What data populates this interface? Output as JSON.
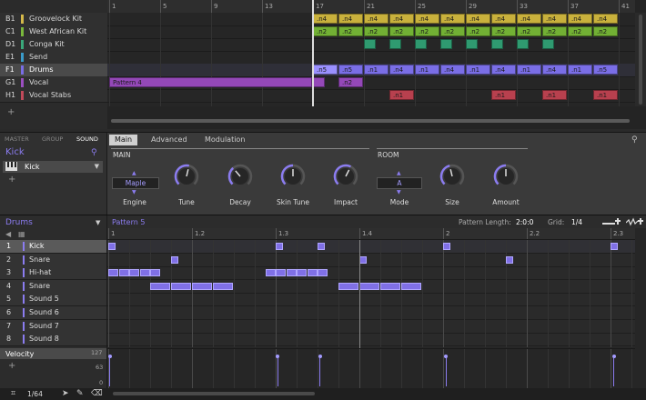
{
  "arranger": {
    "bars": [
      "1",
      "5",
      "9",
      "13",
      "17",
      "21",
      "25",
      "29",
      "33",
      "37",
      "41"
    ],
    "groups": [
      {
        "id": "B1",
        "name": "Groovelock Kit",
        "color": "#d4b84a"
      },
      {
        "id": "C1",
        "name": "West African Kit",
        "color": "#7ab83c"
      },
      {
        "id": "D1",
        "name": "Conga Kit",
        "color": "#3aa87a"
      },
      {
        "id": "E1",
        "name": "Send",
        "color": "#3a9ac8"
      },
      {
        "id": "F1",
        "name": "Drums",
        "color": "#7a6ee6"
      },
      {
        "id": "G1",
        "name": "Vocal",
        "color": "#9b4fc0"
      },
      {
        "id": "H1",
        "name": "Vocal Stabs",
        "color": "#c04a5a"
      }
    ],
    "add_label": "+",
    "clips": [
      {
        "lane": 0,
        "start": 17,
        "len": 2,
        "label": ".n4",
        "color": "#c9b13c"
      },
      {
        "lane": 0,
        "start": 19,
        "len": 2,
        "label": ".n4",
        "color": "#c9b13c"
      },
      {
        "lane": 0,
        "start": 21,
        "len": 2,
        "label": ".n4",
        "color": "#c9b13c"
      },
      {
        "lane": 0,
        "start": 23,
        "len": 2,
        "label": ".n4",
        "color": "#c9b13c"
      },
      {
        "lane": 0,
        "start": 25,
        "len": 2,
        "label": ".n4",
        "color": "#c9b13c"
      },
      {
        "lane": 0,
        "start": 27,
        "len": 2,
        "label": ".n4",
        "color": "#c9b13c"
      },
      {
        "lane": 0,
        "start": 29,
        "len": 2,
        "label": ".n4",
        "color": "#c9b13c"
      },
      {
        "lane": 0,
        "start": 31,
        "len": 2,
        "label": ".n4",
        "color": "#c9b13c"
      },
      {
        "lane": 0,
        "start": 33,
        "len": 2,
        "label": ".n4",
        "color": "#c9b13c"
      },
      {
        "lane": 0,
        "start": 35,
        "len": 2,
        "label": ".n4",
        "color": "#c9b13c"
      },
      {
        "lane": 0,
        "start": 37,
        "len": 2,
        "label": ".n4",
        "color": "#c9b13c"
      },
      {
        "lane": 0,
        "start": 39,
        "len": 2,
        "label": ".n4",
        "color": "#c9b13c"
      },
      {
        "lane": 1,
        "start": 17,
        "len": 2,
        "label": ".n2",
        "color": "#72b034"
      },
      {
        "lane": 1,
        "start": 19,
        "len": 2,
        "label": ".n2",
        "color": "#72b034"
      },
      {
        "lane": 1,
        "start": 21,
        "len": 2,
        "label": ".n2",
        "color": "#72b034"
      },
      {
        "lane": 1,
        "start": 23,
        "len": 2,
        "label": ".n2",
        "color": "#72b034"
      },
      {
        "lane": 1,
        "start": 25,
        "len": 2,
        "label": ".n2",
        "color": "#72b034"
      },
      {
        "lane": 1,
        "start": 27,
        "len": 2,
        "label": ".n2",
        "color": "#72b034"
      },
      {
        "lane": 1,
        "start": 29,
        "len": 2,
        "label": ".n2",
        "color": "#72b034"
      },
      {
        "lane": 1,
        "start": 31,
        "len": 2,
        "label": ".n2",
        "color": "#72b034"
      },
      {
        "lane": 1,
        "start": 33,
        "len": 2,
        "label": ".n2",
        "color": "#72b034"
      },
      {
        "lane": 1,
        "start": 35,
        "len": 2,
        "label": ".n2",
        "color": "#72b034"
      },
      {
        "lane": 1,
        "start": 37,
        "len": 2,
        "label": ".n2",
        "color": "#72b034"
      },
      {
        "lane": 1,
        "start": 39,
        "len": 2,
        "label": ".n2",
        "color": "#72b034"
      },
      {
        "lane": 2,
        "start": 21,
        "len": 1,
        "label": "",
        "color": "#2f9a70"
      },
      {
        "lane": 2,
        "start": 23,
        "len": 1,
        "label": "",
        "color": "#2f9a70"
      },
      {
        "lane": 2,
        "start": 25,
        "len": 1,
        "label": "",
        "color": "#2f9a70"
      },
      {
        "lane": 2,
        "start": 27,
        "len": 1,
        "label": "",
        "color": "#2f9a70"
      },
      {
        "lane": 2,
        "start": 29,
        "len": 1,
        "label": "",
        "color": "#2f9a70"
      },
      {
        "lane": 2,
        "start": 31,
        "len": 1,
        "label": "",
        "color": "#2f9a70"
      },
      {
        "lane": 2,
        "start": 33,
        "len": 1,
        "label": "",
        "color": "#2f9a70"
      },
      {
        "lane": 2,
        "start": 35,
        "len": 1,
        "label": "",
        "color": "#2f9a70"
      },
      {
        "lane": 4,
        "start": 17,
        "len": 2,
        "label": ".n5",
        "color": "#9a90ff"
      },
      {
        "lane": 4,
        "start": 19,
        "len": 2,
        "label": ".n5",
        "color": "#7a6ee6"
      },
      {
        "lane": 4,
        "start": 21,
        "len": 2,
        "label": ".n1",
        "color": "#7a6ee6"
      },
      {
        "lane": 4,
        "start": 23,
        "len": 2,
        "label": ".n4",
        "color": "#7a6ee6"
      },
      {
        "lane": 4,
        "start": 25,
        "len": 2,
        "label": ".n1",
        "color": "#7a6ee6"
      },
      {
        "lane": 4,
        "start": 27,
        "len": 2,
        "label": ".n4",
        "color": "#7a6ee6"
      },
      {
        "lane": 4,
        "start": 29,
        "len": 2,
        "label": ".n1",
        "color": "#7a6ee6"
      },
      {
        "lane": 4,
        "start": 31,
        "len": 2,
        "label": ".n4",
        "color": "#7a6ee6"
      },
      {
        "lane": 4,
        "start": 33,
        "len": 2,
        "label": ".n1",
        "color": "#7a6ee6"
      },
      {
        "lane": 4,
        "start": 35,
        "len": 2,
        "label": ".n4",
        "color": "#7a6ee6"
      },
      {
        "lane": 4,
        "start": 37,
        "len": 2,
        "label": ".n1",
        "color": "#7a6ee6"
      },
      {
        "lane": 4,
        "start": 39,
        "len": 2,
        "label": ".n5",
        "color": "#7a6ee6"
      },
      {
        "lane": 5,
        "start": 1,
        "len": 16,
        "label": "Pattern 4",
        "color": "#9448b8"
      },
      {
        "lane": 5,
        "start": 17,
        "len": 1,
        "label": "",
        "color": "#9448b8"
      },
      {
        "lane": 5,
        "start": 19,
        "len": 2,
        "label": ".n2",
        "color": "#9448b8"
      },
      {
        "lane": 6,
        "start": 23,
        "len": 2,
        "label": ".n1",
        "color": "#b8404e"
      },
      {
        "lane": 6,
        "start": 31,
        "len": 2,
        "label": ".n1",
        "color": "#b8404e"
      },
      {
        "lane": 6,
        "start": 35,
        "len": 2,
        "label": ".n1",
        "color": "#b8404e"
      },
      {
        "lane": 6,
        "start": 39,
        "len": 2,
        "label": ".n1",
        "color": "#b8404e"
      }
    ]
  },
  "control": {
    "tabs": [
      "MASTER",
      "GROUP",
      "SOUND"
    ],
    "sound_name": "Kick",
    "slot_name": "Kick",
    "add_label": "+",
    "page_tabs": [
      "Main",
      "Advanced",
      "Modulation"
    ],
    "sections": [
      "MAIN",
      "ROOM"
    ],
    "engine": {
      "value": "Maple",
      "label": "Engine"
    },
    "mode": {
      "value": "A",
      "label": "Mode"
    },
    "knobs": [
      {
        "label": "Tune",
        "value": 0.55
      },
      {
        "label": "Decay",
        "value": 0.35
      },
      {
        "label": "Skin Tune",
        "value": 0.5
      },
      {
        "label": "Impact",
        "value": 0.6
      },
      {
        "label": "Size",
        "value": 0.45
      },
      {
        "label": "Amount",
        "value": 0.5
      }
    ]
  },
  "pattern": {
    "group_name": "Drums",
    "pattern_name": "Pattern 5",
    "length_label": "Pattern Length:",
    "length_value": "2:0:0",
    "grid_label": "Grid:",
    "grid_value": "1/4",
    "ruler": [
      "1",
      "1.2",
      "1.3",
      "1.4",
      "2",
      "2.2",
      "2.3"
    ],
    "sounds": [
      {
        "num": "1",
        "name": "Kick"
      },
      {
        "num": "2",
        "name": "Snare"
      },
      {
        "num": "3",
        "name": "Hi-hat"
      },
      {
        "num": "4",
        "name": "Snare"
      },
      {
        "num": "5",
        "name": "Sound 5"
      },
      {
        "num": "6",
        "name": "Sound 6"
      },
      {
        "num": "7",
        "name": "Sound 7"
      },
      {
        "num": "8",
        "name": "Sound 8"
      }
    ],
    "notes": [
      {
        "row": 0,
        "start": 0,
        "len": 1
      },
      {
        "row": 0,
        "start": 8,
        "len": 1
      },
      {
        "row": 0,
        "start": 10,
        "len": 1
      },
      {
        "row": 0,
        "start": 16,
        "len": 1
      },
      {
        "row": 0,
        "start": 24,
        "len": 1
      },
      {
        "row": 1,
        "start": 3,
        "len": 1
      },
      {
        "row": 1,
        "start": 12,
        "len": 1
      },
      {
        "row": 1,
        "start": 19,
        "len": 1
      },
      {
        "row": 2,
        "start": 0,
        "len": 1
      },
      {
        "row": 2,
        "start": 1,
        "len": 1
      },
      {
        "row": 2,
        "start": 2,
        "len": 1
      },
      {
        "row": 2,
        "start": 3,
        "len": 1
      },
      {
        "row": 2,
        "start": 4,
        "len": 1
      },
      {
        "row": 2,
        "start": 15,
        "len": 1
      },
      {
        "row": 2,
        "start": 16,
        "len": 1
      },
      {
        "row": 2,
        "start": 17,
        "len": 1
      },
      {
        "row": 2,
        "start": 18,
        "len": 1
      },
      {
        "row": 2,
        "start": 19,
        "len": 1
      },
      {
        "row": 2,
        "start": 20,
        "len": 1
      },
      {
        "row": 3,
        "start": 2,
        "len": 2
      },
      {
        "row": 3,
        "start": 4,
        "len": 2
      },
      {
        "row": 3,
        "start": 6,
        "len": 2
      },
      {
        "row": 3,
        "start": 8,
        "len": 2
      },
      {
        "row": 3,
        "start": 20,
        "len": 2
      },
      {
        "row": 3,
        "start": 22,
        "len": 2
      },
      {
        "row": 3,
        "start": 24,
        "len": 2
      },
      {
        "row": 3,
        "start": 26,
        "len": 2
      }
    ],
    "velocity_label": "Velocity",
    "velocity_scale": [
      "127",
      "63",
      "0"
    ],
    "velocity_add": "+",
    "velocities": [
      {
        "step": 0,
        "value": 127
      },
      {
        "step": 8,
        "value": 127
      },
      {
        "step": 10,
        "value": 127
      },
      {
        "step": 16,
        "value": 127
      },
      {
        "step": 24,
        "value": 127
      }
    ],
    "step_size": "1/64"
  }
}
